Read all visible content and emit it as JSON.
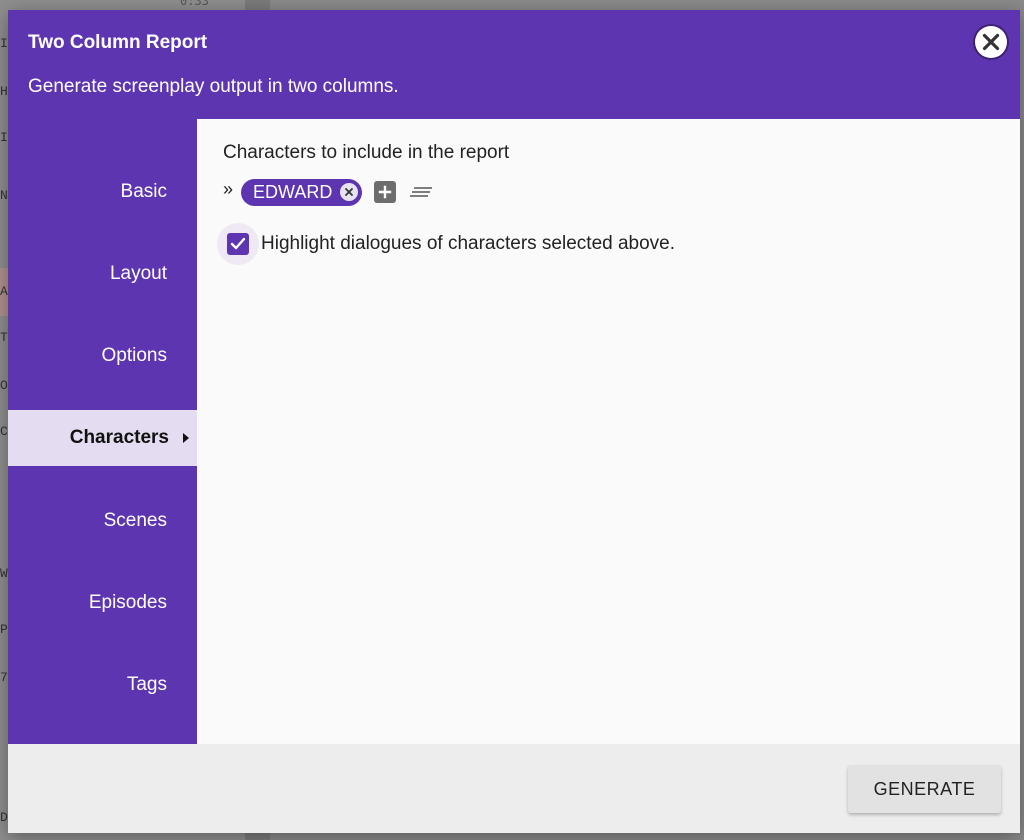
{
  "background": {
    "time_label": "0:33",
    "edge_letters": [
      "I",
      "H",
      "I",
      "N",
      "A",
      "T",
      "O",
      "C",
      "W",
      "P",
      "7",
      "D"
    ]
  },
  "dialog": {
    "title": "Two Column Report",
    "subtitle": "Generate screenplay output in two columns.",
    "close_icon": "close-icon"
  },
  "sidebar": {
    "items": [
      {
        "label": "Basic",
        "active": false
      },
      {
        "label": "Layout",
        "active": false
      },
      {
        "label": "Options",
        "active": false
      },
      {
        "label": "Characters",
        "active": true
      },
      {
        "label": "Scenes",
        "active": false
      },
      {
        "label": "Episodes",
        "active": false
      },
      {
        "label": "Tags",
        "active": false
      }
    ]
  },
  "characters": {
    "section_label": "Characters to include in the report",
    "chevron": "»",
    "selected": [
      {
        "name": "EDWARD"
      }
    ],
    "highlight_checkbox": {
      "checked": true,
      "label": "Highlight dialogues of characters selected above."
    }
  },
  "footer": {
    "generate_label": "GENERATE"
  },
  "colors": {
    "accent": "#5e35b1",
    "active_nav_bg": "#e4dcf0",
    "content_bg": "#fafafa",
    "footer_bg": "#ededed"
  }
}
